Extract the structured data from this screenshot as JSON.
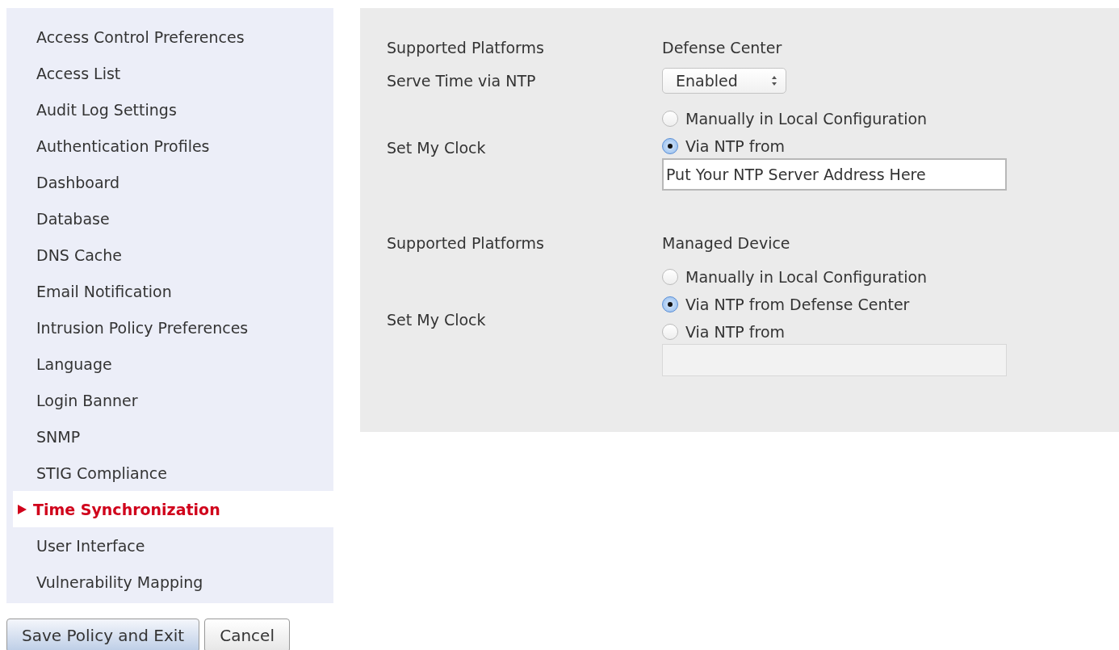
{
  "sidebar": {
    "items": [
      {
        "label": "Access Control Preferences",
        "selected": false
      },
      {
        "label": "Access List",
        "selected": false
      },
      {
        "label": "Audit Log Settings",
        "selected": false
      },
      {
        "label": "Authentication Profiles",
        "selected": false
      },
      {
        "label": "Dashboard",
        "selected": false
      },
      {
        "label": "Database",
        "selected": false
      },
      {
        "label": "DNS Cache",
        "selected": false
      },
      {
        "label": "Email Notification",
        "selected": false
      },
      {
        "label": "Intrusion Policy Preferences",
        "selected": false
      },
      {
        "label": "Language",
        "selected": false
      },
      {
        "label": "Login Banner",
        "selected": false
      },
      {
        "label": "SNMP",
        "selected": false
      },
      {
        "label": "STIG Compliance",
        "selected": false
      },
      {
        "label": "Time Synchronization",
        "selected": true
      },
      {
        "label": "User Interface",
        "selected": false
      },
      {
        "label": "Vulnerability Mapping",
        "selected": false
      }
    ]
  },
  "buttons": [
    {
      "label": "Save Policy and Exit",
      "kind": "primary"
    },
    {
      "label": "Cancel",
      "kind": "secondary"
    }
  ],
  "sections": [
    {
      "platform_label": "Supported Platforms",
      "platform": "Defense Center",
      "serve_time": {
        "label": "Serve Time via NTP",
        "value": "Enabled"
      },
      "clock": {
        "label": "Set My Clock",
        "options": [
          {
            "label": "Manually in Local Configuration",
            "selected": false
          },
          {
            "label": "Via NTP from",
            "selected": true
          }
        ],
        "field": {
          "value": "Put Your NTP Server Address Here",
          "disabled": false
        }
      }
    },
    {
      "platform_label": "Supported Platforms",
      "platform": "Managed Device",
      "clock": {
        "label": "Set My Clock",
        "options": [
          {
            "label": "Manually in Local Configuration",
            "selected": false
          },
          {
            "label": "Via NTP from Defense Center",
            "selected": true
          },
          {
            "label": "Via NTP from",
            "selected": false
          }
        ],
        "field": {
          "disabled": true
        }
      }
    }
  ]
}
